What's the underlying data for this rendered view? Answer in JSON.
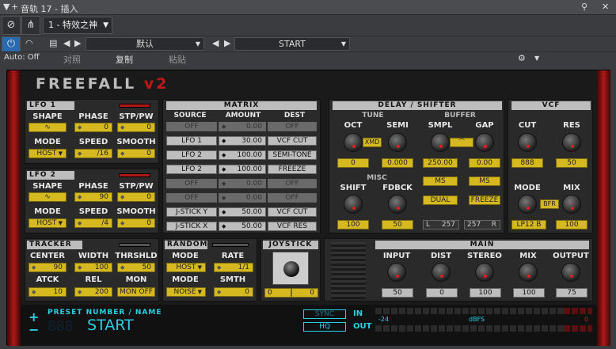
{
  "titlebar": {
    "title": "音轨 17 - 插入"
  },
  "track": {
    "name": "1 - 特效之神"
  },
  "preset": {
    "name": "默认",
    "start": "START",
    "auto": "Auto: Off",
    "compare": "对照",
    "copy": "复制",
    "paste": "粘贴"
  },
  "logo": {
    "main": "FREEFALL",
    "ver": "v2"
  },
  "lfo1": {
    "title": "LFO 1",
    "shape": "SHAPE",
    "phase": "PHASE",
    "stp": "STP/PW",
    "phase_v": "0",
    "stp_v": "0",
    "mode": "MODE",
    "speed": "SPEED",
    "smooth": "SMOOTH",
    "mode_v": "HOST",
    "speed_v": "/16",
    "smooth_v": "0"
  },
  "lfo2": {
    "title": "LFO 2",
    "shape": "SHAPE",
    "phase": "PHASE",
    "stp": "STP/PW",
    "phase_v": "90",
    "stp_v": "0",
    "mode": "MODE",
    "speed": "SPEED",
    "smooth": "SMOOTH",
    "mode_v": "HOST",
    "speed_v": "/4",
    "smooth_v": "0"
  },
  "matrix": {
    "title": "MATRIX",
    "source": "SOURCE",
    "amount": "AMOUNT",
    "dest": "DEST",
    "rows": [
      {
        "src": "OFF",
        "amt": "0.00",
        "dst": "OFF",
        "on": false
      },
      {
        "src": "LFO 1",
        "amt": "30.00",
        "dst": "VCF CUT",
        "on": true
      },
      {
        "src": "LFO 2",
        "amt": "100.00",
        "dst": "SEMI-TONE",
        "on": true
      },
      {
        "src": "LFO 2",
        "amt": "100.00",
        "dst": "FREEZE",
        "on": true
      },
      {
        "src": "OFF",
        "amt": "0.00",
        "dst": "OFF",
        "on": false
      },
      {
        "src": "OFF",
        "amt": "0.00",
        "dst": "OFF",
        "on": false
      },
      {
        "src": "J-STICK Y",
        "amt": "50.00",
        "dst": "VCF CUT",
        "on": true
      },
      {
        "src": "J-STICK X",
        "amt": "50.00",
        "dst": "VCF RES",
        "on": true
      }
    ]
  },
  "delay": {
    "title": "DELAY / SHIFTER",
    "tune": "TUNE",
    "oct": "OCT",
    "semi": "SEMI",
    "oct_v": "0",
    "semi_v": "0.000",
    "xmd": "XMD",
    "buffer": "BUFFER",
    "smpl": "SMPL",
    "gap": "GAP",
    "smpl_v": "250.00",
    "gap_v": "0.00",
    "ms1": "MS",
    "ms2": "MS",
    "dual": "DUAL",
    "freeze": "FREEZE",
    "misc": "MISC",
    "shift": "SHIFT",
    "fdbck": "FDBCK",
    "shift_v": "100",
    "fdbck_v": "50",
    "l": "L",
    "l_v": "257",
    "r": "R",
    "r_v": "257"
  },
  "vcf": {
    "title": "VCF",
    "cut": "CUT",
    "res": "RES",
    "cut_v": "888",
    "res_v": "50",
    "mode": "MODE",
    "mix": "MIX",
    "bfr": "BFR",
    "mode_v": "LP12 B",
    "mix_v": "100"
  },
  "tracker": {
    "title": "TRACKER",
    "center": "CENTER",
    "width": "WIDTH",
    "thrshld": "THRSHLD",
    "center_v": "90",
    "width_v": "100",
    "thrshld_v": "50",
    "atck": "ATCK",
    "rel": "REL",
    "mon": "MON",
    "atck_v": "10",
    "rel_v": "200",
    "mon_v": "MON OFF"
  },
  "random": {
    "title": "RANDOM",
    "mode": "MODE",
    "rate": "RATE",
    "mode_v": "HOST",
    "rate_v": "1/1",
    "mode2": "MODE",
    "smth": "SMTH",
    "mode2_v": "NOISE",
    "smth_v": "0"
  },
  "joystick": {
    "title": "JOYSTICK",
    "x": "0",
    "y": "0"
  },
  "main": {
    "title": "MAIN",
    "input": "INPUT",
    "dist": "DIST",
    "stereo": "STEREO",
    "mix": "MIX",
    "output": "OUTPUT",
    "input_v": "50",
    "dist_v": "0",
    "stereo_v": "100",
    "mix_v": "100",
    "output_v": "75"
  },
  "bottom": {
    "preset_label": "PRESET NUMBER / NAME",
    "preset_num": "888",
    "preset_name": "START",
    "sync": "SYNC",
    "hq": "HQ",
    "in": "IN",
    "out": "OUT",
    "db": "-24",
    "dbfs": "dBFS",
    "zero": "0"
  }
}
